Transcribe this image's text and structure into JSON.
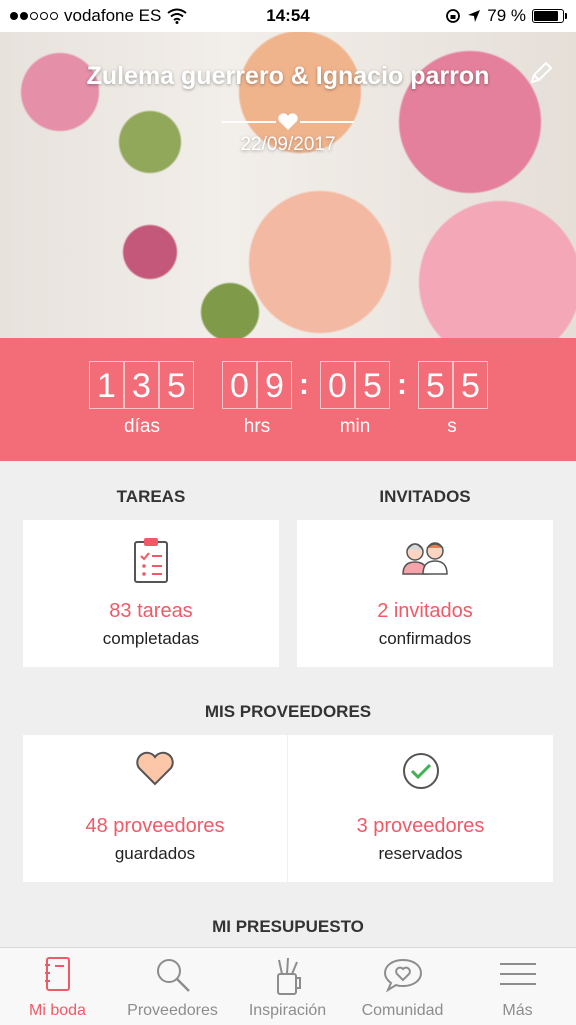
{
  "status_bar": {
    "carrier": "vodafone ES",
    "time": "14:54",
    "battery": "79 %"
  },
  "hero": {
    "couple": "Zulema guerrero & Ignacio parron",
    "date": "22/09/2017"
  },
  "countdown": {
    "days_digits": [
      "1",
      "3",
      "5"
    ],
    "hours_digits": [
      "0",
      "9"
    ],
    "minutes_digits": [
      "0",
      "5"
    ],
    "seconds_digits": [
      "5",
      "5"
    ],
    "labels": {
      "days": "días",
      "hours": "hrs",
      "minutes": "min",
      "seconds": "s"
    }
  },
  "tasks": {
    "section": "TAREAS",
    "count": "83 tareas",
    "label": "completadas"
  },
  "guests": {
    "section": "INVITADOS",
    "count": "2 invitados",
    "label": "confirmados"
  },
  "vendors": {
    "section": "MIS PROVEEDORES",
    "saved": {
      "count": "48 proveedores",
      "label": "guardados"
    },
    "booked": {
      "count": "3 proveedores",
      "label": "reservados"
    }
  },
  "budget": {
    "section": "MI PRESUPUESTO"
  },
  "tabbar": {
    "items": [
      {
        "label": "Mi boda",
        "icon": "notebook-icon",
        "active": true
      },
      {
        "label": "Proveedores",
        "icon": "search-icon",
        "active": false
      },
      {
        "label": "Inspiración",
        "icon": "pencil-cup-icon",
        "active": false
      },
      {
        "label": "Comunidad",
        "icon": "chat-heart-icon",
        "active": false
      },
      {
        "label": "Más",
        "icon": "menu-icon",
        "active": false
      }
    ]
  },
  "colors": {
    "accent": "#f05a67",
    "countdown_bg": "#f36d79",
    "background": "#efefef"
  }
}
